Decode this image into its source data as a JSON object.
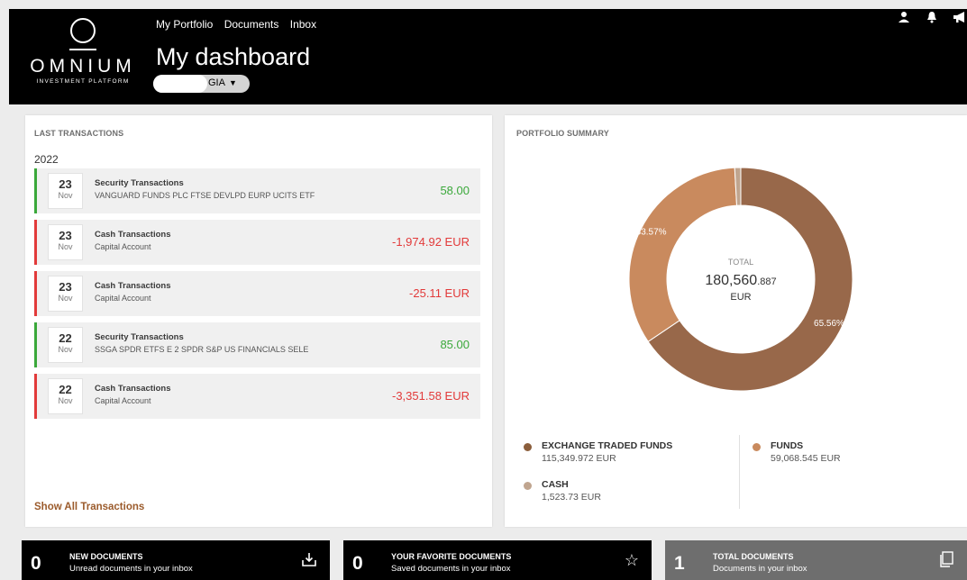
{
  "header": {
    "logo_name": "OMNIUM",
    "logo_subtitle": "INVESTMENT PLATFORM",
    "nav": [
      "My Portfolio",
      "Documents",
      "Inbox"
    ],
    "title": "My dashboard",
    "account_label": "GIA",
    "icons": [
      "user-icon",
      "bell-icon",
      "megaphone-icon"
    ]
  },
  "transactions": {
    "title": "LAST TRANSACTIONS",
    "year": "2022",
    "items": [
      {
        "day": "23",
        "month": "Nov",
        "type": "Security Transactions",
        "desc": "VANGUARD FUNDS PLC FTSE DEVLPD EURP UCITS ETF",
        "amount": "58.00",
        "sign": "pos"
      },
      {
        "day": "23",
        "month": "Nov",
        "type": "Cash Transactions",
        "desc": "Capital Account",
        "amount": "-1,974.92 EUR",
        "sign": "neg"
      },
      {
        "day": "23",
        "month": "Nov",
        "type": "Cash Transactions",
        "desc": "Capital Account",
        "amount": "-25.11 EUR",
        "sign": "neg"
      },
      {
        "day": "22",
        "month": "Nov",
        "type": "Security Transactions",
        "desc": "SSGA SPDR ETFS E 2 SPDR S&P US FINANCIALS SELE",
        "amount": "85.00",
        "sign": "pos"
      },
      {
        "day": "22",
        "month": "Nov",
        "type": "Cash Transactions",
        "desc": "Capital Account",
        "amount": "-3,351.58 EUR",
        "sign": "neg"
      }
    ],
    "show_all": "Show All Transactions"
  },
  "portfolio": {
    "title": "PORTFOLIO SUMMARY",
    "total_label": "TOTAL",
    "total_main": "180,560",
    "total_decimals": ".887",
    "total_currency": "EUR",
    "legend": [
      {
        "name": "EXCHANGE TRADED FUNDS",
        "value": "115,349.972 EUR",
        "color": "#8b5e3c"
      },
      {
        "name": "FUNDS",
        "value": "59,068.545 EUR",
        "color": "#c98a5e"
      },
      {
        "name": "CASH",
        "value": "1,523.73 EUR",
        "color": "#c0a58f"
      }
    ]
  },
  "chart_data": {
    "type": "pie",
    "categories": [
      "EXCHANGE TRADED FUNDS",
      "FUNDS",
      "CASH"
    ],
    "values": [
      65.56,
      33.57,
      0.87
    ],
    "labels": [
      "65.56%",
      "33.57%",
      ""
    ],
    "colors": [
      "#98684a",
      "#c98a5e",
      "#c0a58f"
    ]
  },
  "tiles": [
    {
      "count": "0",
      "title": "NEW DOCUMENTS",
      "sub": "Unread documents in your inbox",
      "icon": "inbox-download-icon",
      "bg": "#000000"
    },
    {
      "count": "0",
      "title": "YOUR FAVORITE DOCUMENTS",
      "sub": "Saved documents in your inbox",
      "icon": "star-icon",
      "bg": "#000000"
    },
    {
      "count": "1",
      "title": "TOTAL DOCUMENTS",
      "sub": "Documents in your inbox",
      "icon": "documents-icon",
      "bg": "#6e6e6e"
    }
  ]
}
